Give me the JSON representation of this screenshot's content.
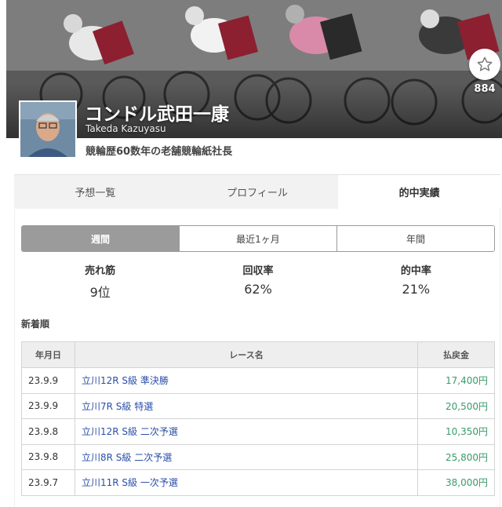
{
  "profile": {
    "name": "コンドル武田一康",
    "name_en": "Takeda Kazuyasu",
    "tagline": "競輪歴60数年の老舗競輪紙社長",
    "favorite_count": "884",
    "favorite_icon": "star-outline-icon"
  },
  "tabs": [
    {
      "label": "予想一覧",
      "active": false
    },
    {
      "label": "プロフィール",
      "active": false
    },
    {
      "label": "的中実績",
      "active": true
    }
  ],
  "period": [
    {
      "label": "週間",
      "active": true
    },
    {
      "label": "最近1ヶ月",
      "active": false
    },
    {
      "label": "年間",
      "active": false
    }
  ],
  "stats": [
    {
      "label": "売れ筋",
      "value": "9位"
    },
    {
      "label": "回収率",
      "value": "62%"
    },
    {
      "label": "的中率",
      "value": "21%"
    }
  ],
  "sort_label": "新着順",
  "table": {
    "headers": {
      "date": "年月日",
      "race": "レース名",
      "payout": "払戻金"
    },
    "rows": [
      {
        "date": "23.9.9",
        "race": "立川12R S級 準決勝",
        "payout": "17,400円"
      },
      {
        "date": "23.9.9",
        "race": "立川7R S級 特選",
        "payout": "20,500円"
      },
      {
        "date": "23.9.8",
        "race": "立川12R S級 二次予選",
        "payout": "10,350円"
      },
      {
        "date": "23.9.8",
        "race": "立川8R S級 二次予選",
        "payout": "25,800円"
      },
      {
        "date": "23.9.7",
        "race": "立川11R S級 一次予選",
        "payout": "38,000円"
      }
    ]
  },
  "colors": {
    "link": "#2a4fa8",
    "payout": "#3a9a6a",
    "active_period": "#9b9b9b"
  }
}
